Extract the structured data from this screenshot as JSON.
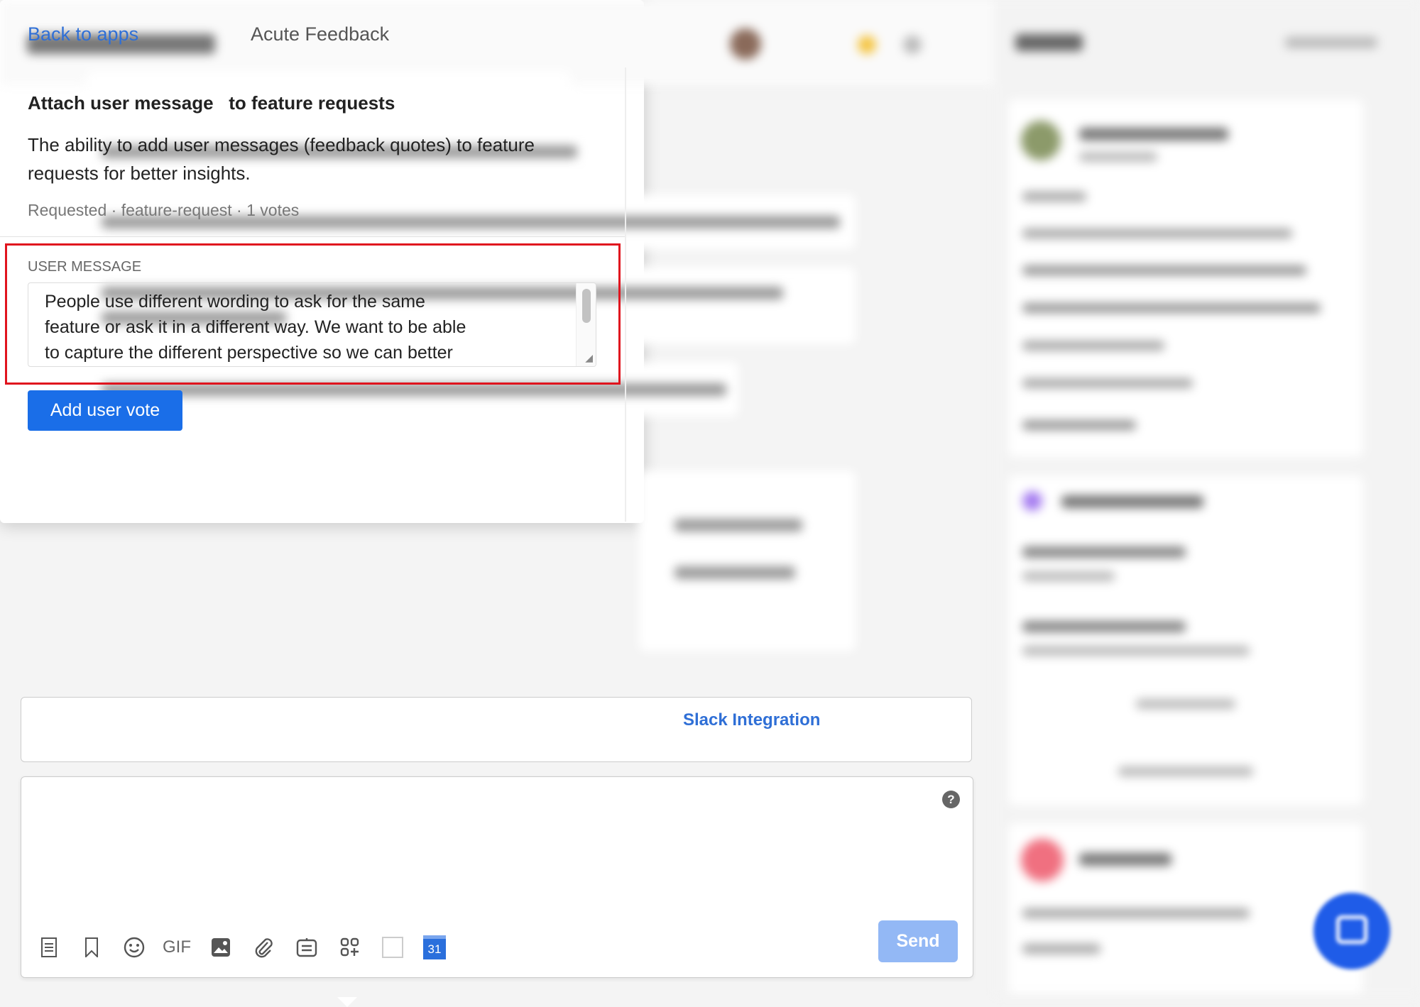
{
  "popup": {
    "back_label": "Back to apps",
    "app_title": "Acute Feedback",
    "feature_title": "Attach user message   to feature requests",
    "description_line1": "The ability to add user messages (feedback quotes) to feature",
    "description_line2": "requests for better insights.",
    "meta": "Requested · feature-request · 1 votes",
    "user_message_label": "USER MESSAGE",
    "user_message_value": "People use different wording to ask for the same\nfeature or ask it in a different way. We want to be able\nto capture the different perspective so we can better",
    "add_vote_label": "Add user vote"
  },
  "conversation": {
    "app_card_label": "Slack Integration",
    "send_label": "Send",
    "toolbar": [
      {
        "icon": "note-icon"
      },
      {
        "icon": "bookmark-icon"
      },
      {
        "icon": "emoji-icon"
      },
      {
        "icon": "gif-icon",
        "label": "GIF"
      },
      {
        "icon": "image-icon"
      },
      {
        "icon": "attachment-icon"
      },
      {
        "icon": "article-icon"
      },
      {
        "icon": "apps-icon"
      },
      {
        "icon": "blank-app-icon"
      },
      {
        "icon": "google-calendar-icon",
        "label": "31"
      }
    ]
  },
  "colors": {
    "accent": "#1a6ee8",
    "link": "#2f6fd6",
    "highlight_border": "#e0141e",
    "send_disabled": "#93b8f5"
  }
}
